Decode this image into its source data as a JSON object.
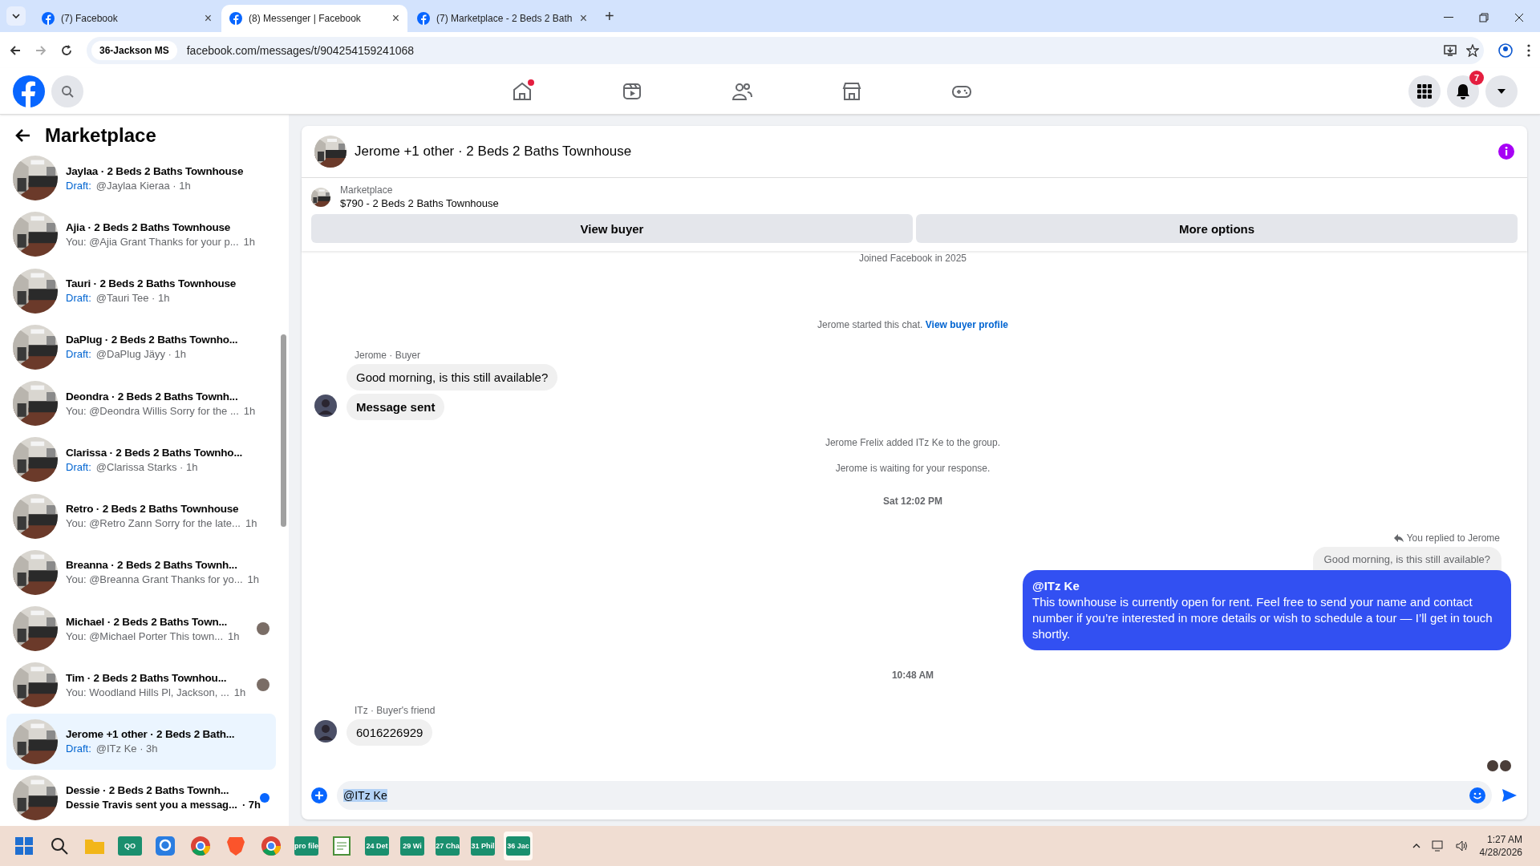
{
  "browser": {
    "tabs": [
      {
        "title": "(7) Facebook",
        "close": "×",
        "selected": false
      },
      {
        "title": "(8) Messenger | Facebook",
        "close": "×",
        "selected": true
      },
      {
        "title": "(7) Marketplace - 2 Beds 2 Bath",
        "close": "×",
        "selected": false
      }
    ],
    "new_tab": "+",
    "site_chip": "36-Jackson MS",
    "url": "facebook.com/messages/t/904254159241068"
  },
  "top_nav": {
    "icons": [
      {
        "kind": "home",
        "dot": true
      },
      {
        "kind": "video",
        "dot": false
      },
      {
        "kind": "friends",
        "dot": false
      },
      {
        "kind": "marketplace",
        "dot": false
      },
      {
        "kind": "gaming",
        "dot": false
      }
    ],
    "notification_count": "7"
  },
  "sidebar": {
    "title": "Marketplace",
    "conversations": [
      {
        "title": "Jaylaa · 2 Beds 2 Baths Townhouse",
        "draft_label": "Draft:",
        "preview": "@Jaylaa Kieraa · 1h",
        "selected": false,
        "unread": false,
        "receipt": false
      },
      {
        "title": "Ajia · 2 Beds 2 Baths Townhouse",
        "preview": "You: @Ajia Grant Thanks for your p...",
        "time": "1h",
        "selected": false,
        "unread": false,
        "receipt": false
      },
      {
        "title": "Tauri · 2 Beds 2 Baths Townhouse",
        "draft_label": "Draft:",
        "preview": "@Tauri Tee · 1h",
        "selected": false,
        "unread": false,
        "receipt": false
      },
      {
        "title": "DaPlug · 2 Beds 2 Baths Townho...",
        "draft_label": "Draft:",
        "preview": "@DaPlug Jäyy · 1h",
        "selected": false,
        "unread": false,
        "receipt": false
      },
      {
        "title": "Deondra · 2 Beds 2 Baths Townh...",
        "preview": "You: @Deondra Willis Sorry for the ...",
        "time": "1h",
        "selected": false,
        "unread": false,
        "receipt": false
      },
      {
        "title": "Clarissa · 2 Beds 2 Baths Townho...",
        "draft_label": "Draft:",
        "preview": "@Clarissa Starks · 1h",
        "selected": false,
        "unread": false,
        "receipt": false
      },
      {
        "title": "Retro · 2 Beds 2 Baths Townhouse",
        "preview": "You: @Retro Zann Sorry for the late...",
        "time": "1h",
        "selected": false,
        "unread": false,
        "receipt": false
      },
      {
        "title": "Breanna · 2 Beds 2 Baths Townh...",
        "preview": "You: @Breanna Grant Thanks for yo...",
        "time": "1h",
        "selected": false,
        "unread": false,
        "receipt": false
      },
      {
        "title": "Michael · 2 Beds 2 Baths Town...",
        "preview": "You: @Michael Porter This town...",
        "time": "1h",
        "selected": false,
        "unread": false,
        "receipt": true
      },
      {
        "title": "Tim · 2 Beds 2 Baths Townhou...",
        "preview": "You: Woodland Hills Pl, Jackson, ...",
        "time": "1h",
        "selected": false,
        "unread": false,
        "receipt": true
      },
      {
        "title": "Jerome +1 other · 2 Beds 2 Bath...",
        "draft_label": "Draft:",
        "preview": "@ITz Ke · 3h",
        "selected": true,
        "unread": false,
        "receipt": false
      },
      {
        "title": "Dessie · 2 Beds 2 Baths Townh...",
        "preview": "Dessie Travis sent you a messag...",
        "time": "· 7h",
        "selected": false,
        "unread": true,
        "receipt": false
      }
    ]
  },
  "chat": {
    "title": "Jerome +1 other · 2 Beds 2 Baths Townhouse",
    "listing": {
      "label": "Marketplace",
      "text": "$790 - 2 Beds 2 Baths Townhouse"
    },
    "buttons": [
      "View buyer",
      "More options"
    ],
    "messages": [
      {
        "kind": "info",
        "text": "Joined Facebook in 2025"
      },
      {
        "kind": "info",
        "text": "Jerome started this chat.",
        "link": "View buyer profile"
      },
      {
        "kind": "incoming",
        "sender": "Jerome · Buyer",
        "bubbles": [
          {
            "text": "Good morning, is this still available?",
            "bold": false
          },
          {
            "text": "Message sent",
            "bold": true
          }
        ]
      },
      {
        "kind": "info",
        "text": "Jerome Frelix added ITz Ke to the group."
      },
      {
        "kind": "info",
        "text": "Jerome is waiting for your response."
      },
      {
        "kind": "timestamp",
        "text": "Sat 12:02 PM"
      },
      {
        "kind": "outgoing",
        "reply_note": "You replied to Jerome",
        "quoted": "Good morning, is this still available?",
        "mention": "@ITz Ke",
        "text": "This townhouse is currently open for rent. Feel free to send your name and contact number if you’re interested in more details or wish to schedule a tour — I’ll get in touch shortly."
      },
      {
        "kind": "timestamp",
        "text": "10:48 AM"
      },
      {
        "kind": "incoming",
        "sender": "ITz · Buyer's friend",
        "bubbles": [
          {
            "text": "6016226929",
            "bold": false
          }
        ]
      }
    ],
    "composer": {
      "value": "@ITz Ke"
    }
  },
  "taskbar": {
    "apps": [
      {
        "kind": "start"
      },
      {
        "kind": "search"
      },
      {
        "kind": "folder"
      },
      {
        "kind": "tile",
        "label": "QO"
      },
      {
        "kind": "maps"
      },
      {
        "kind": "chrome"
      },
      {
        "kind": "brave"
      },
      {
        "kind": "chrome"
      },
      {
        "kind": "tile",
        "label": "pro file"
      },
      {
        "kind": "notepad"
      },
      {
        "kind": "tile",
        "label": "24 Det"
      },
      {
        "kind": "tile",
        "label": "29 Wi"
      },
      {
        "kind": "tile",
        "label": "27 Cha"
      },
      {
        "kind": "tile",
        "label": "31 Phil"
      },
      {
        "kind": "tile",
        "label": "36 Jac",
        "active": true
      }
    ],
    "time": "1:27 AM",
    "date": "4/28/2026"
  }
}
